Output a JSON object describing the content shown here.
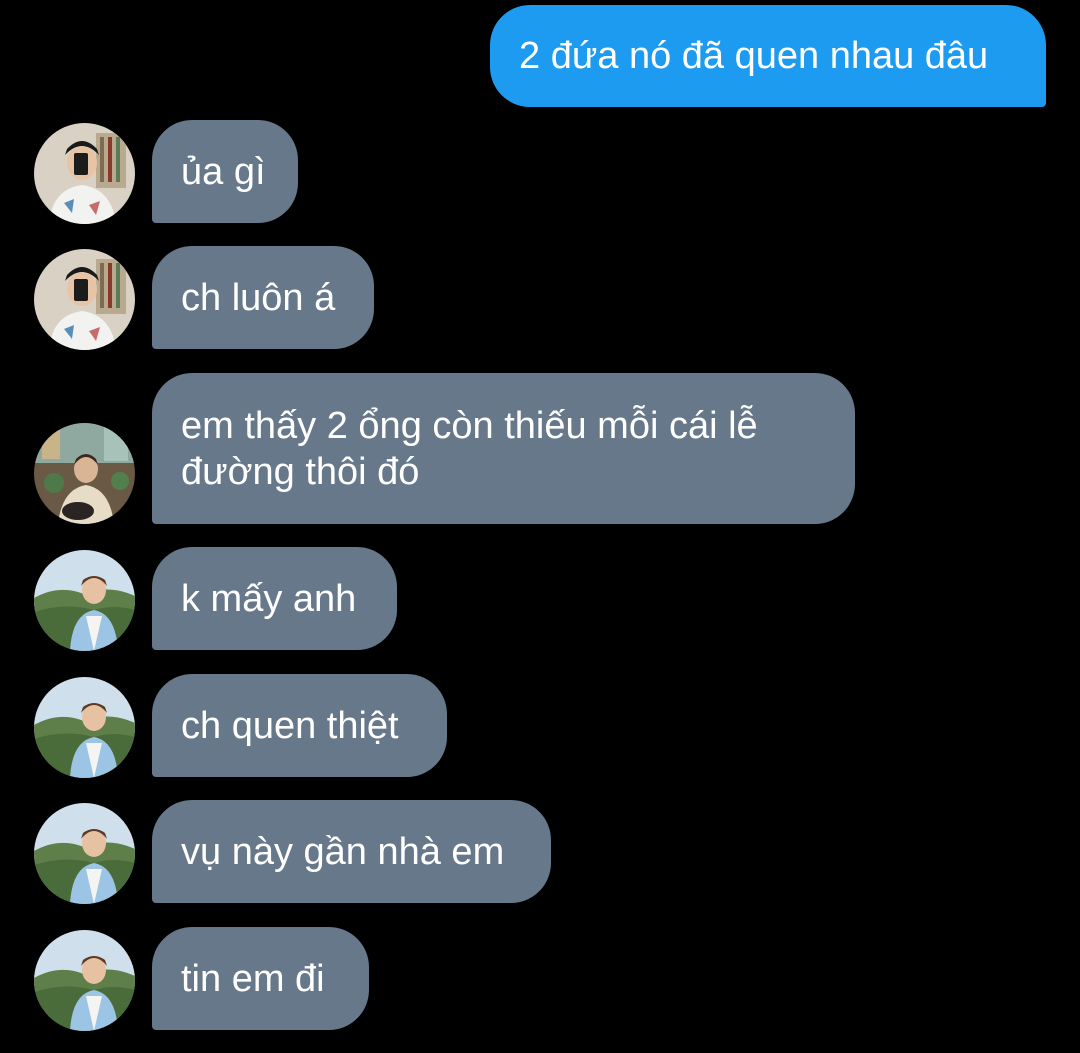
{
  "conversation": {
    "messages": [
      {
        "id": "m1",
        "sender": "self",
        "text": "2 đứa nó đã quen nhau đâu"
      },
      {
        "id": "m2",
        "sender": "contact-a",
        "avatar_icon": "avatar-mirror-selfie-icon",
        "text": "ủa gì"
      },
      {
        "id": "m3",
        "sender": "contact-a",
        "avatar_icon": "avatar-mirror-selfie-icon",
        "text": "ch luôn á"
      },
      {
        "id": "m4",
        "sender": "contact-b",
        "avatar_icon": "avatar-cafe-portrait-icon",
        "text": "em thấy 2 ổng còn thiếu mỗi cái lễ đường thôi đó"
      },
      {
        "id": "m5",
        "sender": "contact-c",
        "avatar_icon": "avatar-mountain-portrait-icon",
        "text": "k mấy anh"
      },
      {
        "id": "m6",
        "sender": "contact-c",
        "avatar_icon": "avatar-mountain-portrait-icon",
        "text": "ch quen thiệt"
      },
      {
        "id": "m7",
        "sender": "contact-c",
        "avatar_icon": "avatar-mountain-portrait-icon",
        "text": "vụ này gần nhà em"
      },
      {
        "id": "m8",
        "sender": "contact-c",
        "avatar_icon": "avatar-mountain-portrait-icon",
        "text": "tin em đi"
      }
    ]
  },
  "colors": {
    "background": "#000000",
    "outgoing_bubble": "#1d9bf0",
    "incoming_bubble": "#66788a",
    "text": "#ffffff"
  }
}
